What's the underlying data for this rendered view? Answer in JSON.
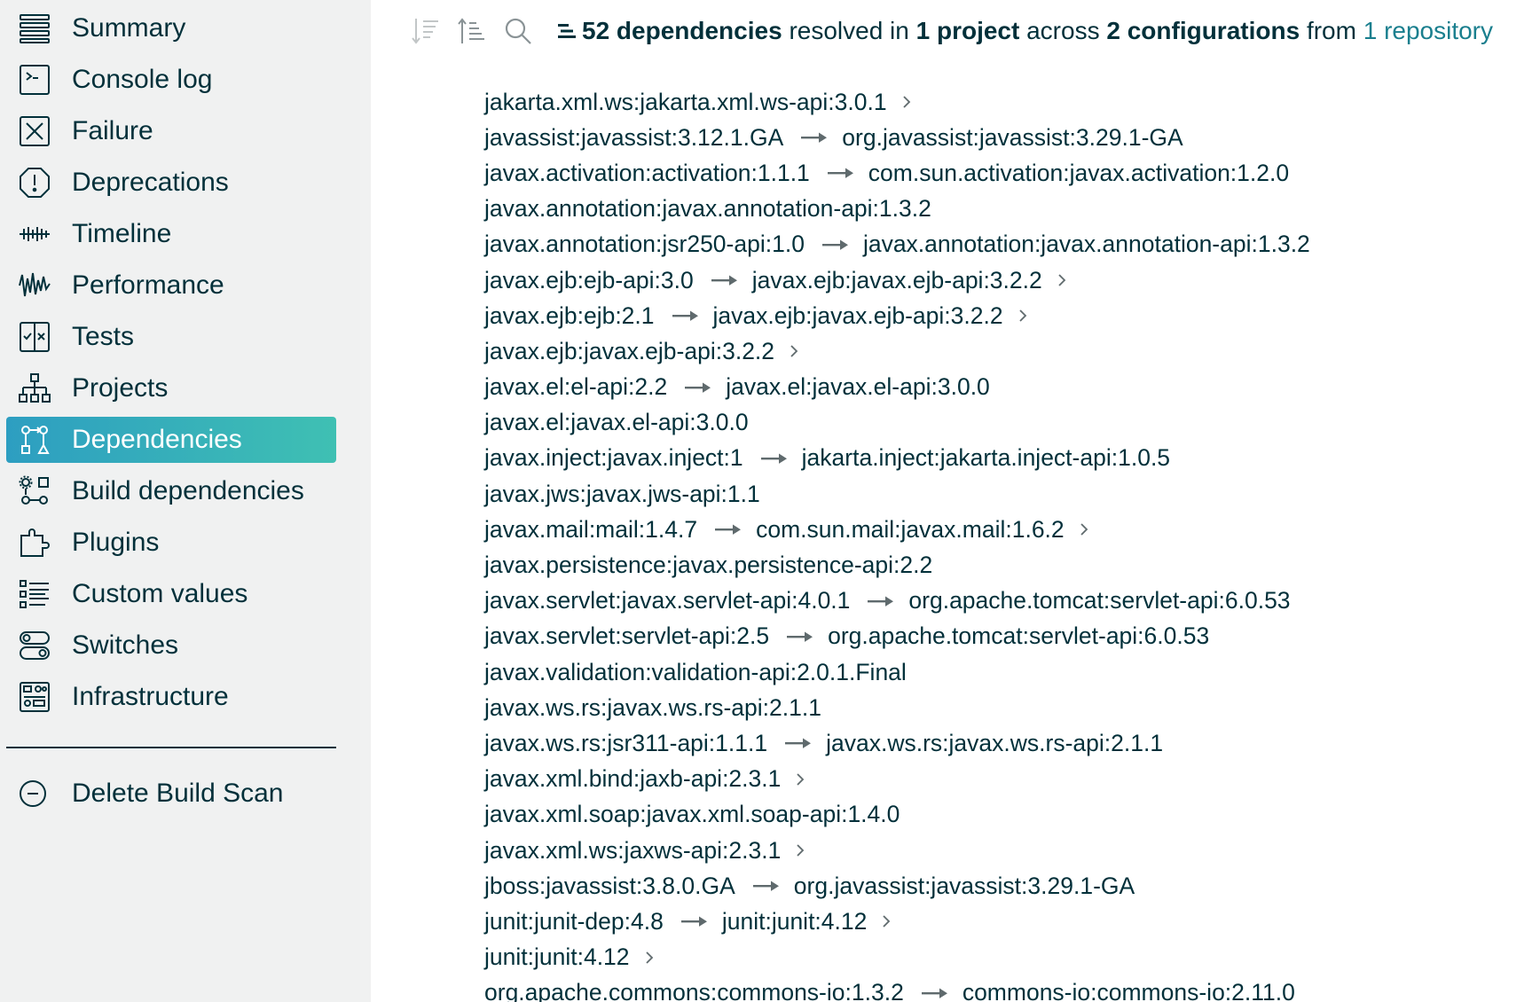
{
  "sidebar": {
    "items": [
      {
        "label": "Summary",
        "icon": "summary-icon",
        "active": false
      },
      {
        "label": "Console log",
        "icon": "console-icon",
        "active": false
      },
      {
        "label": "Failure",
        "icon": "failure-icon",
        "active": false
      },
      {
        "label": "Deprecations",
        "icon": "deprecations-icon",
        "active": false
      },
      {
        "label": "Timeline",
        "icon": "timeline-icon",
        "active": false
      },
      {
        "label": "Performance",
        "icon": "performance-icon",
        "active": false
      },
      {
        "label": "Tests",
        "icon": "tests-icon",
        "active": false
      },
      {
        "label": "Projects",
        "icon": "projects-icon",
        "active": false
      },
      {
        "label": "Dependencies",
        "icon": "dependencies-icon",
        "active": true
      },
      {
        "label": "Build dependencies",
        "icon": "build-dependencies-icon",
        "active": false
      },
      {
        "label": "Plugins",
        "icon": "plugins-icon",
        "active": false
      },
      {
        "label": "Custom values",
        "icon": "custom-values-icon",
        "active": false
      },
      {
        "label": "Switches",
        "icon": "switches-icon",
        "active": false
      },
      {
        "label": "Infrastructure",
        "icon": "infrastructure-icon",
        "active": false
      }
    ],
    "delete_label": "Delete Build Scan"
  },
  "toolbar": {
    "icons": [
      "sort-descending-icon",
      "sort-ascending-icon",
      "search-icon"
    ]
  },
  "summary": {
    "count": "52 dependencies",
    "text1": "resolved in",
    "projects": "1 project",
    "text2": "across",
    "configurations": "2 configurations",
    "text3": "from",
    "repository": "1 repository"
  },
  "colors": {
    "sidebar_bg": "#f0f1f1",
    "active_gradient_start": "#2d9ec1",
    "active_gradient_end": "#3fc0b3",
    "text": "#02303a",
    "link": "#1a7f8e"
  },
  "dependencies": [
    {
      "requested": "jakarta.xml.ws:jakarta.xml.ws-api:3.0.1",
      "selected": "",
      "expandable": true
    },
    {
      "requested": "javassist:javassist:3.12.1.GA",
      "selected": "org.javassist:javassist:3.29.1-GA",
      "expandable": false
    },
    {
      "requested": "javax.activation:activation:1.1.1",
      "selected": "com.sun.activation:javax.activation:1.2.0",
      "expandable": false
    },
    {
      "requested": "javax.annotation:javax.annotation-api:1.3.2",
      "selected": "",
      "expandable": false
    },
    {
      "requested": "javax.annotation:jsr250-api:1.0",
      "selected": "javax.annotation:javax.annotation-api:1.3.2",
      "expandable": false
    },
    {
      "requested": "javax.ejb:ejb-api:3.0",
      "selected": "javax.ejb:javax.ejb-api:3.2.2",
      "expandable": true
    },
    {
      "requested": "javax.ejb:ejb:2.1",
      "selected": "javax.ejb:javax.ejb-api:3.2.2",
      "expandable": true
    },
    {
      "requested": "javax.ejb:javax.ejb-api:3.2.2",
      "selected": "",
      "expandable": true
    },
    {
      "requested": "javax.el:el-api:2.2",
      "selected": "javax.el:javax.el-api:3.0.0",
      "expandable": false
    },
    {
      "requested": "javax.el:javax.el-api:3.0.0",
      "selected": "",
      "expandable": false
    },
    {
      "requested": "javax.inject:javax.inject:1",
      "selected": "jakarta.inject:jakarta.inject-api:1.0.5",
      "expandable": false
    },
    {
      "requested": "javax.jws:javax.jws-api:1.1",
      "selected": "",
      "expandable": false
    },
    {
      "requested": "javax.mail:mail:1.4.7",
      "selected": "com.sun.mail:javax.mail:1.6.2",
      "expandable": true
    },
    {
      "requested": "javax.persistence:javax.persistence-api:2.2",
      "selected": "",
      "expandable": false
    },
    {
      "requested": "javax.servlet:javax.servlet-api:4.0.1",
      "selected": "org.apache.tomcat:servlet-api:6.0.53",
      "expandable": false
    },
    {
      "requested": "javax.servlet:servlet-api:2.5",
      "selected": "org.apache.tomcat:servlet-api:6.0.53",
      "expandable": false
    },
    {
      "requested": "javax.validation:validation-api:2.0.1.Final",
      "selected": "",
      "expandable": false
    },
    {
      "requested": "javax.ws.rs:javax.ws.rs-api:2.1.1",
      "selected": "",
      "expandable": false
    },
    {
      "requested": "javax.ws.rs:jsr311-api:1.1.1",
      "selected": "javax.ws.rs:javax.ws.rs-api:2.1.1",
      "expandable": false
    },
    {
      "requested": "javax.xml.bind:jaxb-api:2.3.1",
      "selected": "",
      "expandable": true
    },
    {
      "requested": "javax.xml.soap:javax.xml.soap-api:1.4.0",
      "selected": "",
      "expandable": false
    },
    {
      "requested": "javax.xml.ws:jaxws-api:2.3.1",
      "selected": "",
      "expandable": true
    },
    {
      "requested": "jboss:javassist:3.8.0.GA",
      "selected": "org.javassist:javassist:3.29.1-GA",
      "expandable": false
    },
    {
      "requested": "junit:junit-dep:4.8",
      "selected": "junit:junit:4.12",
      "expandable": true
    },
    {
      "requested": "junit:junit:4.12",
      "selected": "",
      "expandable": true
    },
    {
      "requested": "org.apache.commons:commons-io:1.3.2",
      "selected": "commons-io:commons-io:2.11.0",
      "expandable": false
    }
  ]
}
